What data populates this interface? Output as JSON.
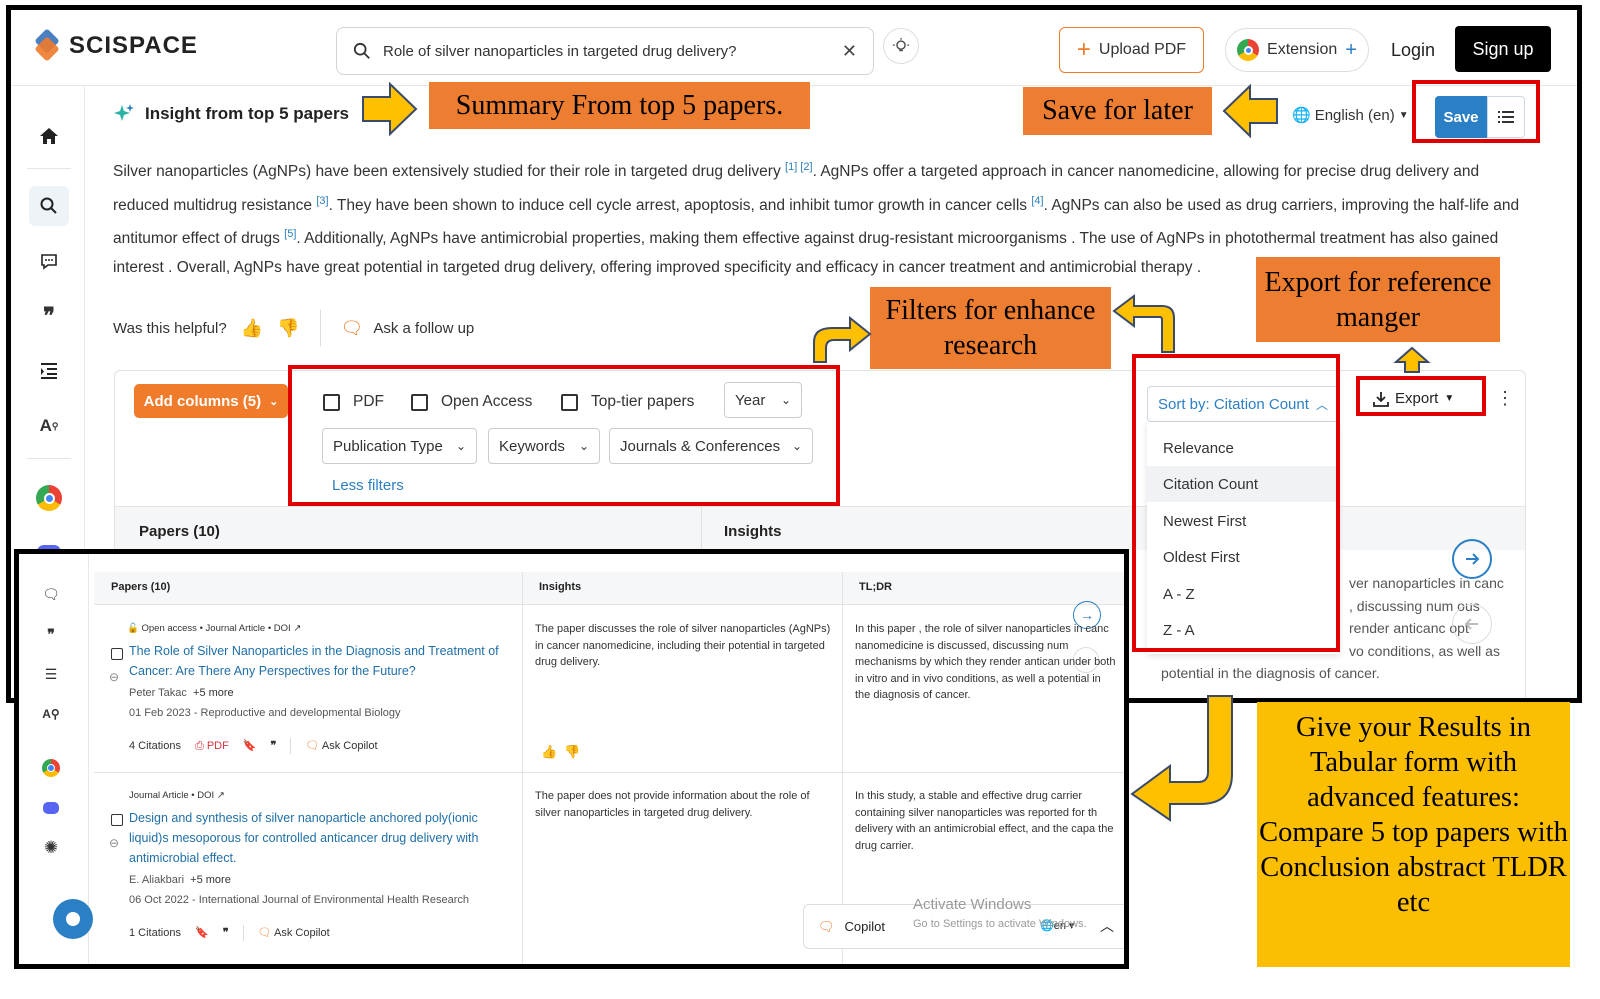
{
  "app": {
    "name": "SCISPACE"
  },
  "search": {
    "query": "Role of silver nanoparticles in targeted drug delivery?"
  },
  "header": {
    "upload_label": "Upload PDF",
    "extension_label": "Extension",
    "login_label": "Login",
    "signup_label": "Sign up"
  },
  "insight": {
    "title": "Insight from top 5 papers",
    "language": "English (en)",
    "save_label": "Save",
    "summary": {
      "s1": "Silver nanoparticles (AgNPs) have been extensively studied for their role in targeted drug delivery ",
      "c1": "[1] [2]",
      "s2": ". AgNPs offer a targeted approach in cancer nanomedicine, allowing for precise drug delivery and reduced multidrug resistance ",
      "c2": "[3]",
      "s3": ". They have been shown to induce cell cycle arrest, apoptosis, and inhibit tumor growth in cancer cells ",
      "c3": "[4]",
      "s4": ". AgNPs can also be used as drug carriers, improving the half-life and antitumor effect of drugs ",
      "c4": "[5]",
      "s5": ". Additionally, AgNPs have antimicrobial properties, making them effective against drug-resistant microorganisms . The use of AgNPs in photothermal treatment has also gained interest . Overall, AgNPs have great potential in targeted drug delivery, offering improved specificity and efficacy in cancer treatment and antimicrobial therapy ."
    },
    "helpful_label": "Was this helpful?",
    "follow_up_label": "Ask a follow up"
  },
  "filters": {
    "add_columns": "Add columns (5)",
    "pdf": "PDF",
    "open_access": "Open Access",
    "top_tier": "Top-tier papers",
    "year": "Year",
    "publication_type": "Publication Type",
    "keywords": "Keywords",
    "journals": "Journals & Conferences",
    "less_filters": "Less filters"
  },
  "sort": {
    "label": "Sort by: Citation Count",
    "options": [
      "Relevance",
      "Citation Count",
      "Newest First",
      "Oldest First",
      "A - Z",
      "Z - A"
    ],
    "selected": "Citation Count"
  },
  "export_label": "Export",
  "table_header": {
    "papers": "Papers (10)",
    "insights": "Insights"
  },
  "behind_text": {
    "line1": "ver nanoparticles in canc",
    "line2": ", discussing num   ous",
    "line3": "render anticanc   opt",
    "line4": "vo conditions, as well as",
    "line5": "potential in the diagnosis of cancer."
  },
  "annotations": {
    "summary": "Summary From top 5 papers.",
    "save": "Save for later",
    "filters": "Filters for enhance research",
    "export": "Export for reference manger",
    "tabular": "Give your Results in Tabular form with advanced features: Compare 5 top papers with Conclusion abstract TLDR etc"
  },
  "inset": {
    "headers": {
      "papers": "Papers (10)",
      "insights": "Insights",
      "tldr": "TL;DR"
    },
    "papers": [
      {
        "meta": "Open access • Journal Article • DOI",
        "title": "The Role of Silver Nanoparticles in the Diagnosis and Treatment of Cancer: Are There Any Perspectives for the Future?",
        "authors": "Peter Takac",
        "more": "+5 more",
        "date_venue": "01 Feb 2023 - Reproductive and developmental Biology",
        "citations": "4 Citations",
        "pdf": "PDF",
        "ask": "Ask Copilot",
        "insight": "The paper discusses the role of silver nanoparticles (AgNPs) in cancer nanomedicine, including their potential in targeted drug delivery.",
        "tldr": "In this paper , the role of silver nanoparticles in canc nanomedicine is discussed, discussing num mechanisms by which they render antican under both in vitro and in vivo conditions, as well a potential in the diagnosis of cancer."
      },
      {
        "meta": "Journal Article • DOI",
        "title": "Design and synthesis of silver nanoparticle anchored poly(ionic liquid)s mesoporous for controlled anticancer drug delivery with antimicrobial effect.",
        "authors": "E. Aliakbari",
        "more": "+5 more",
        "date_venue": "06 Oct 2022 - International Journal of Environmental Health Research",
        "citations": "1 Citations",
        "ask": "Ask Copilot",
        "insight": "The paper does not provide information about the role of silver nanoparticles in targeted drug delivery.",
        "tldr": "In this study, a stable and effective drug carrier containing silver nanoparticles was reported for th delivery with an antimicrobial effect, and the capa the drug carrier."
      }
    ],
    "copilot_label": "Copilot",
    "lang_short": "en",
    "watermark_title": "Activate Windows",
    "watermark_sub": "Go to Settings to activate Windows."
  },
  "colors": {
    "accent_orange": "#ED7D31",
    "primary_blue": "#2B7FC5",
    "highlight_red": "#E00000",
    "callout_yellow": "#FBBE00"
  }
}
